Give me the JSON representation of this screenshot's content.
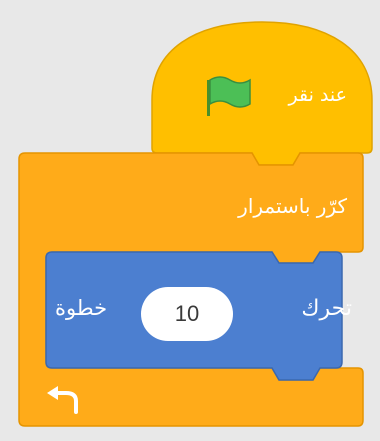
{
  "blocks": {
    "hat": {
      "label": "عند نقر",
      "icon": "green-flag-icon",
      "color": "#ffbf00"
    },
    "forever": {
      "label": "كرّر باستمرار",
      "color": "#ffab19",
      "loop_arrow_icon": "loop-arrow-icon"
    },
    "move": {
      "label": "تحرك",
      "value": "10",
      "unit_label": "خطوة",
      "color": "#4c7fd0"
    }
  }
}
